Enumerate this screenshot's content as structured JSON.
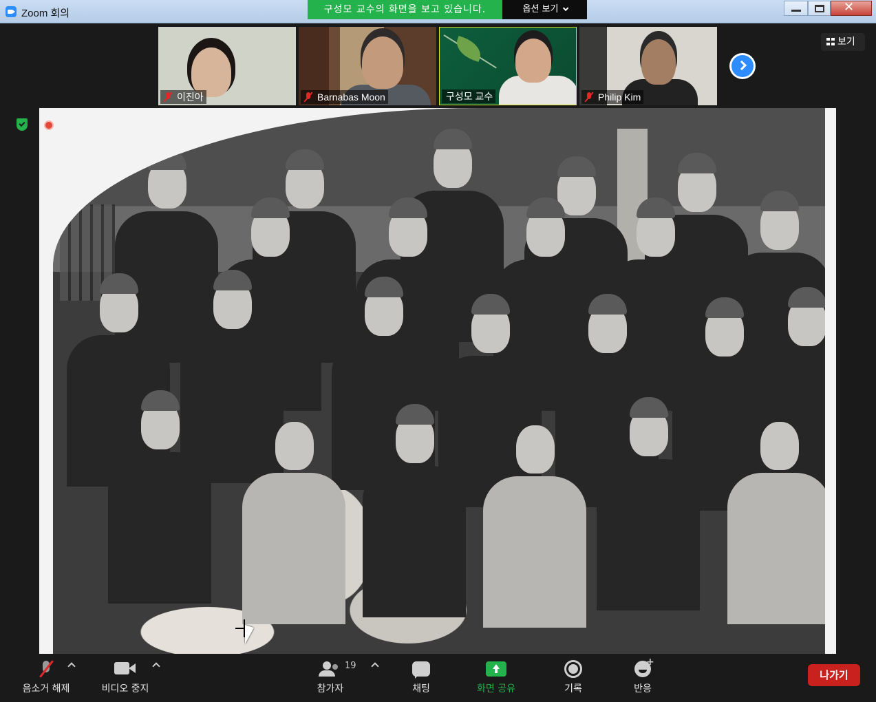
{
  "window": {
    "title": "Zoom 회의"
  },
  "share_banner": {
    "text": "구성모 교수의 화면을 보고 있습니다.",
    "view_options_label": "옵션 보기"
  },
  "gallery": {
    "view_toggle_label": "보기",
    "participants": [
      {
        "name": "이진아",
        "muted": true
      },
      {
        "name": "Barnabas Moon",
        "muted": true
      },
      {
        "name": "구성모 교수",
        "muted": false,
        "active_speaker": true
      },
      {
        "name": "Philip Kim",
        "muted": true
      }
    ],
    "next_page_icon": "chevron-right-icon"
  },
  "shared_content": {
    "description_icon": "recording-indicator-icon"
  },
  "toolbar": {
    "audio_label": "음소거 해제",
    "video_label": "비디오 중지",
    "participants_label": "참가자",
    "participants_count": "19",
    "chat_label": "채팅",
    "share_label": "화면 공유",
    "record_label": "기록",
    "reactions_label": "반응",
    "leave_label": "나가기"
  },
  "colors": {
    "accent_green": "#23b24b",
    "zoom_blue": "#2d8cff",
    "leave_red": "#c9211e",
    "muted_red": "#e02828"
  }
}
